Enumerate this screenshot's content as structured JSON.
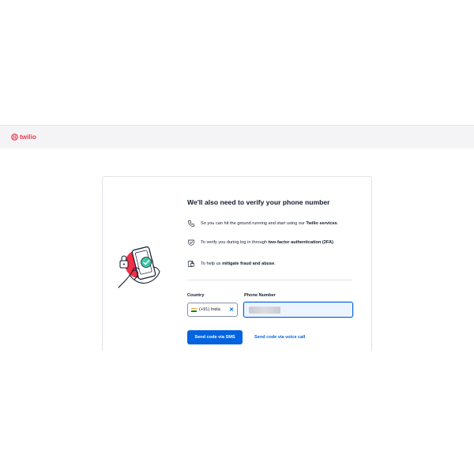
{
  "header": {
    "brand": "twilio"
  },
  "card": {
    "title": "We'll also need to verify your phone number",
    "reasons": [
      {
        "icon": "phone-icon",
        "text_before": "So you can hit the ground running and start using our ",
        "bold": "Twilio services",
        "text_after": "."
      },
      {
        "icon": "shield-check-icon",
        "text_before": "To verify you during log in through ",
        "bold": "two-factor authentication (2FA)",
        "text_after": "."
      },
      {
        "icon": "shield-lock-icon",
        "text_before": "To help us ",
        "bold": "mitigate fraud and abuse",
        "text_after": "."
      }
    ],
    "country": {
      "label": "Country",
      "value": "(+91) India",
      "clear": "✕"
    },
    "phone": {
      "label": "Phone Number"
    },
    "actions": {
      "sms": "Send code via SMS",
      "voice": "Send code via voice call"
    }
  },
  "colors": {
    "brand": "#f22f46",
    "primary": "#0263e0",
    "text": "#121c2d",
    "border": "#e1e3ea"
  }
}
